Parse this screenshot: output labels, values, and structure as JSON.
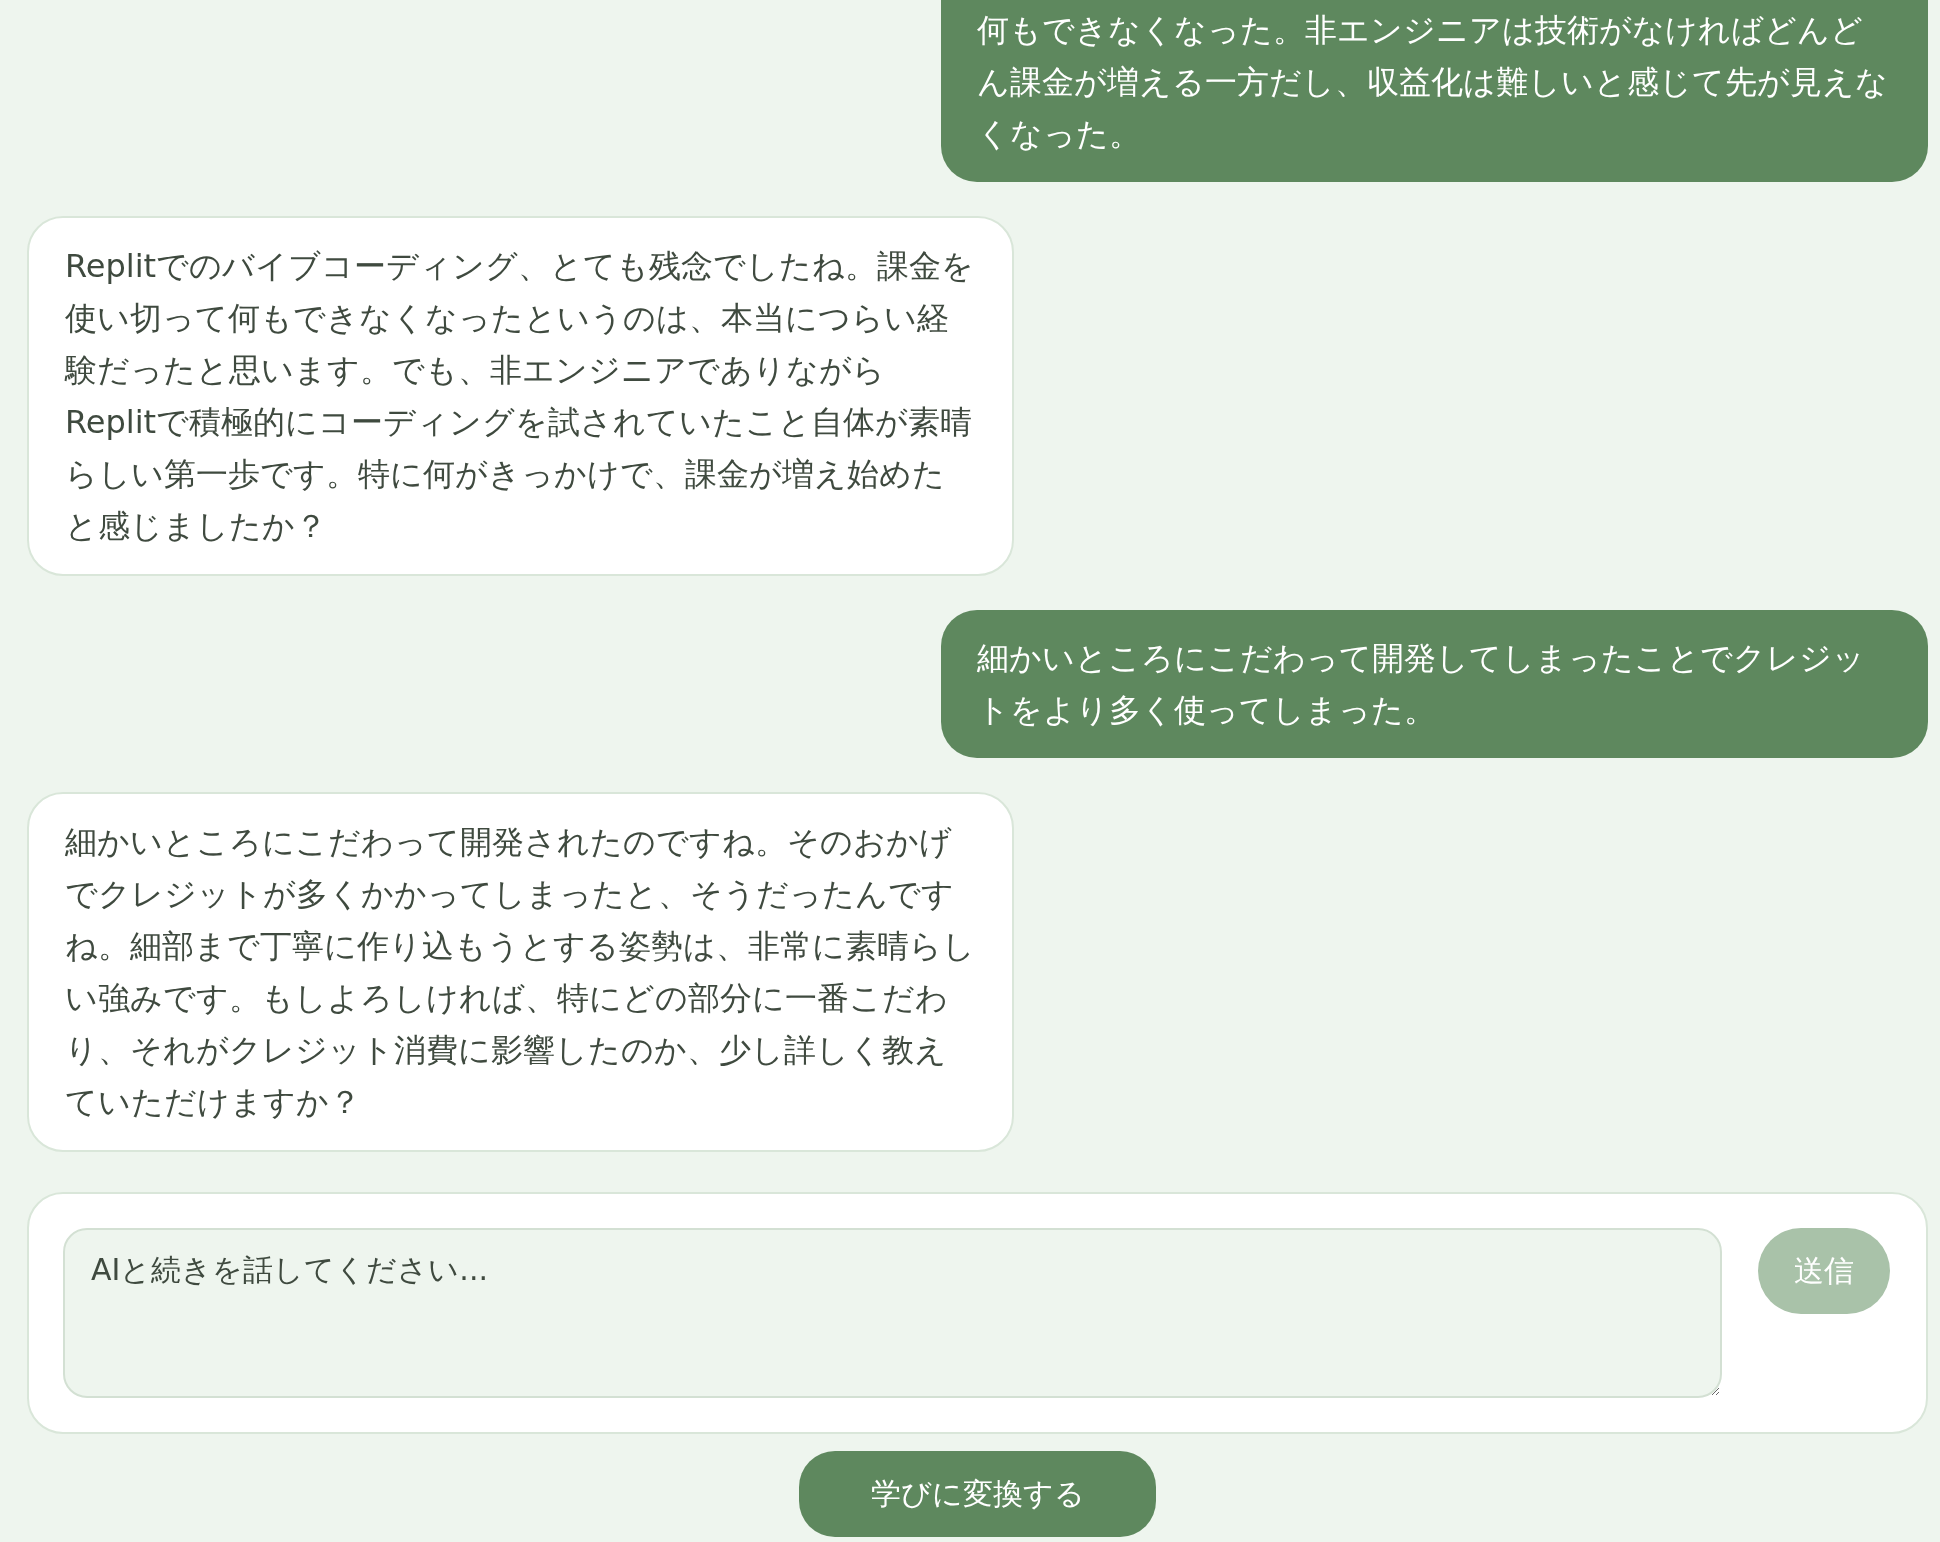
{
  "messages": [
    {
      "kind": "user",
      "text": "何もできなくなった。非エンジニアは技術がなければどんどん課金が増える一方だし、収益化は難しいと感じて先が見えなくなった。"
    },
    {
      "kind": "assistant",
      "text": "Replitでのバイブコーディング、とても残念でしたね。課金を使い切って何もできなくなったというのは、本当につらい経験だったと思います。でも、非エンジニアでありながらReplitで積極的にコーディングを試されていたこと自体が素晴らしい第一歩です。特に何がきっかけで、課金が増え始めたと感じましたか？"
    },
    {
      "kind": "user",
      "text": "細かいところにこだわって開発してしまったことでクレジットをより多く使ってしまった。"
    },
    {
      "kind": "assistant",
      "text": "細かいところにこだわって開発されたのですね。そのおかげでクレジットが多くかかってしまったと、そうだったんですね。細部まで丁寧に作り込もうとする姿勢は、非常に素晴らしい強みです。もしよろしければ、特にどの部分に一番こだわり、それがクレジット消費に影響したのか、少し詳しく教えていただけますか？"
    }
  ],
  "composer": {
    "placeholder": "AIと続きを話してください...",
    "send": {
      "label": "送信",
      "disabled": true
    }
  },
  "convert_button": "学びに変換する"
}
